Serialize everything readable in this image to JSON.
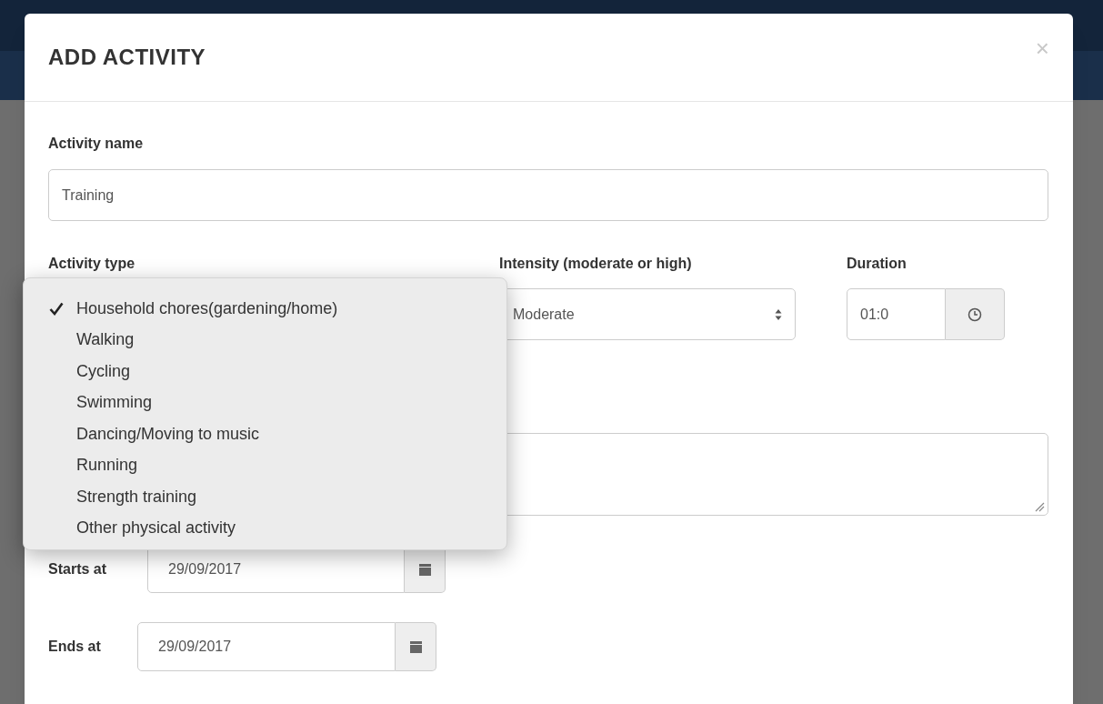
{
  "modal": {
    "title": "ADD ACTIVITY",
    "close": "×"
  },
  "activity_name": {
    "label": "Activity name",
    "value": "Training"
  },
  "activity_type": {
    "label": "Activity type",
    "expanded": true,
    "options": [
      {
        "label": "Household chores(gardening/home)",
        "selected": true
      },
      {
        "label": "Walking",
        "selected": false
      },
      {
        "label": "Cycling",
        "selected": false
      },
      {
        "label": "Swimming",
        "selected": false
      },
      {
        "label": "Dancing/Moving to music",
        "selected": false
      },
      {
        "label": "Running",
        "selected": false
      },
      {
        "label": "Strength training",
        "selected": false
      },
      {
        "label": "Other physical activity",
        "selected": false
      }
    ]
  },
  "intensity": {
    "label": "Intensity (moderate or high)",
    "value": "Moderate"
  },
  "duration": {
    "label": "Duration",
    "value": "01:0"
  },
  "starts_at": {
    "label": "Starts at",
    "value": "29/09/2017"
  },
  "ends_at": {
    "label": "Ends at",
    "value": "29/09/2017"
  }
}
